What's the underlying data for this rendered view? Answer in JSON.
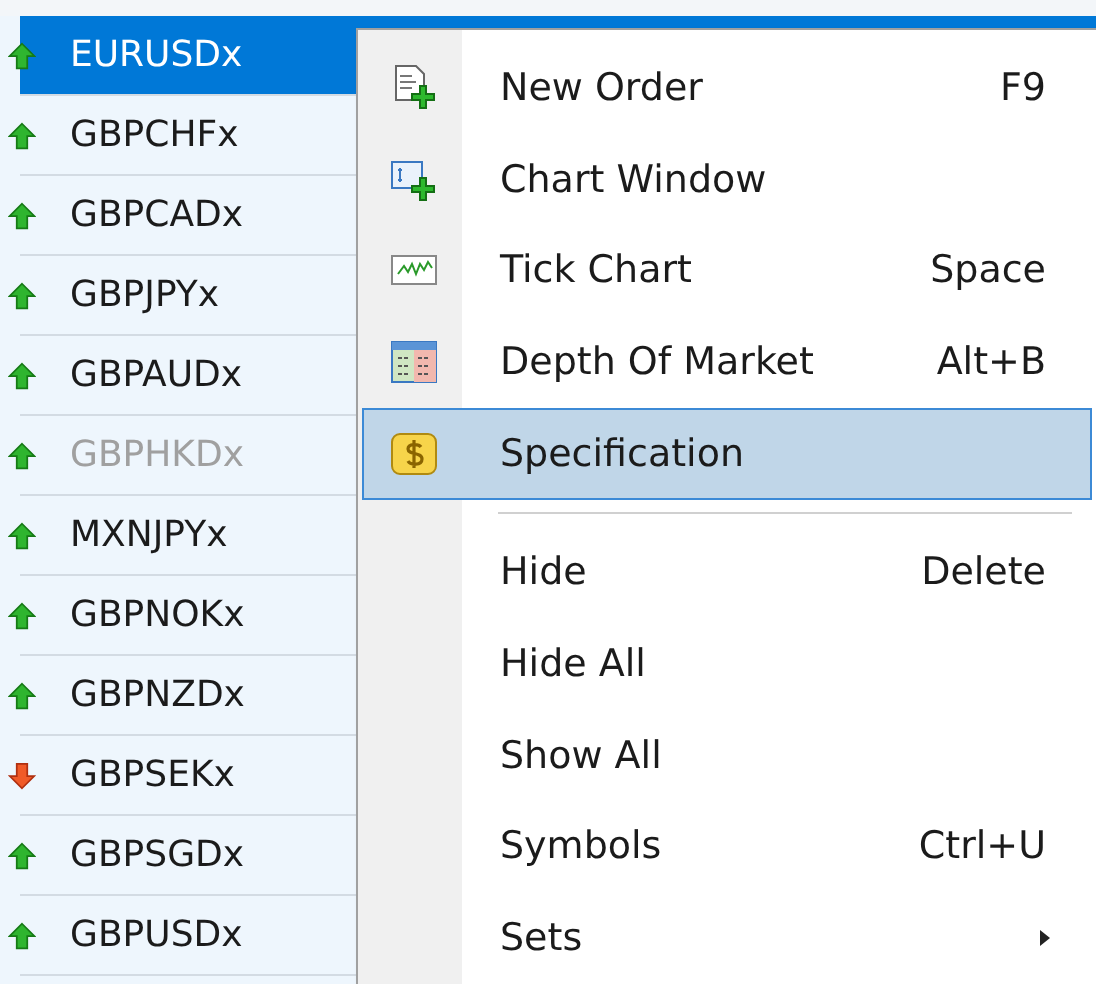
{
  "symbols": [
    {
      "name": "EURUSDx",
      "kind": "up",
      "selected": true,
      "disabled": false
    },
    {
      "name": "GBPCHFx",
      "kind": "up",
      "selected": false,
      "disabled": false
    },
    {
      "name": "GBPCADx",
      "kind": "up",
      "selected": false,
      "disabled": false
    },
    {
      "name": "GBPJPYx",
      "kind": "up",
      "selected": false,
      "disabled": false
    },
    {
      "name": "GBPAUDx",
      "kind": "up",
      "selected": false,
      "disabled": false
    },
    {
      "name": "GBPHKDx",
      "kind": "up",
      "selected": false,
      "disabled": true
    },
    {
      "name": "MXNJPYx",
      "kind": "up",
      "selected": false,
      "disabled": false
    },
    {
      "name": "GBPNOKx",
      "kind": "up",
      "selected": false,
      "disabled": false
    },
    {
      "name": "GBPNZDx",
      "kind": "up",
      "selected": false,
      "disabled": false
    },
    {
      "name": "GBPSEKx",
      "kind": "down",
      "selected": false,
      "disabled": false
    },
    {
      "name": "GBPSGDx",
      "kind": "up",
      "selected": false,
      "disabled": false
    },
    {
      "name": "GBPUSDx",
      "kind": "up",
      "selected": false,
      "disabled": false
    }
  ],
  "context_menu": {
    "items": [
      {
        "kind": "item",
        "label": "New Order",
        "shortcut": "F9",
        "selected": false,
        "submenu": false
      },
      {
        "kind": "item",
        "label": "Chart Window",
        "selected": false,
        "submenu": false
      },
      {
        "kind": "item",
        "label": "Tick Chart",
        "shortcut": "Space",
        "selected": false,
        "submenu": false
      },
      {
        "kind": "item",
        "label": "Depth Of Market",
        "shortcut": "Alt+B",
        "selected": false,
        "submenu": false
      },
      {
        "kind": "item",
        "label": "Specification",
        "selected": true,
        "submenu": false
      },
      {
        "kind": "separator"
      },
      {
        "kind": "item",
        "label": "Hide",
        "shortcut": "Delete",
        "selected": false,
        "submenu": false
      },
      {
        "kind": "item",
        "label": "Hide All",
        "selected": false,
        "submenu": false
      },
      {
        "kind": "item",
        "label": "Show All",
        "selected": false,
        "submenu": false
      },
      {
        "kind": "item",
        "label": "Symbols",
        "shortcut": "Ctrl+U",
        "selected": false,
        "submenu": false
      },
      {
        "kind": "item",
        "label": "Sets",
        "selected": false,
        "submenu": true
      }
    ]
  }
}
